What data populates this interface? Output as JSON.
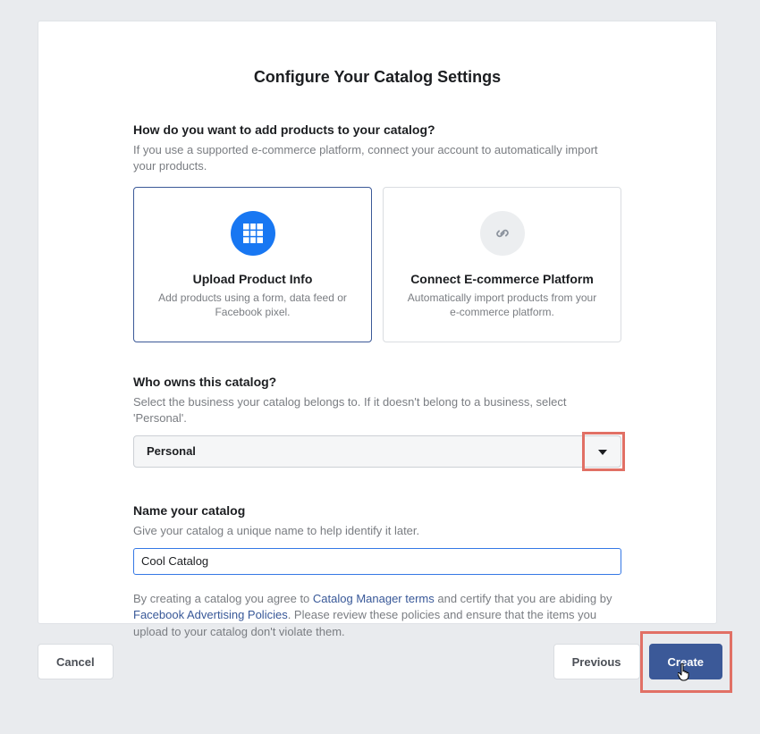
{
  "title": "Configure Your Catalog Settings",
  "addProducts": {
    "heading": "How do you want to add products to your catalog?",
    "desc": "If you use a supported e-commerce platform, connect your account to automatically import your products."
  },
  "options": {
    "upload": {
      "title": "Upload Product Info",
      "desc": "Add products using a form, data feed or Facebook pixel."
    },
    "connect": {
      "title": "Connect E-commerce Platform",
      "desc": "Automatically import products from your e-commerce platform."
    }
  },
  "owner": {
    "heading": "Who owns this catalog?",
    "desc": "Select the business your catalog belongs to. If it doesn't belong to a business, select 'Personal'.",
    "selected": "Personal"
  },
  "name": {
    "heading": "Name your catalog",
    "desc": "Give your catalog a unique name to help identify it later.",
    "value": "Cool Catalog"
  },
  "terms": {
    "prefix": "By creating a catalog you agree to ",
    "link1": "Catalog Manager terms",
    "mid": " and certify that you are abiding by ",
    "link2": "Facebook Advertising Policies",
    "suffix": ". Please review these policies and ensure that the items you upload to your catalog don't violate them."
  },
  "buttons": {
    "cancel": "Cancel",
    "previous": "Previous",
    "create": "Create"
  }
}
